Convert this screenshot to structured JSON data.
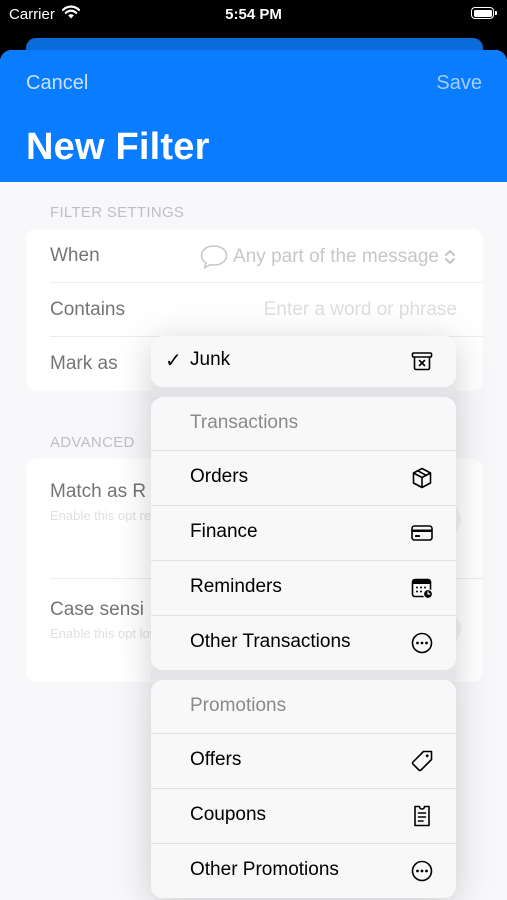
{
  "status_bar": {
    "carrier": "Carrier",
    "time": "5:54 PM"
  },
  "nav": {
    "cancel": "Cancel",
    "save": "Save",
    "title": "New Filter"
  },
  "filter_settings": {
    "header": "FILTER SETTINGS",
    "when_label": "When",
    "when_value": "Any part of the message",
    "contains_label": "Contains",
    "contains_placeholder": "Enter a word or phrase",
    "contains_value": "",
    "mark_as_label": "Mark as"
  },
  "advanced": {
    "header": "ADVANCED",
    "match_regex_title": "Match as R",
    "match_regex_desc": "Enable this opt regular express in PCRE format",
    "case_title": "Case sensi",
    "case_desc": "Enable this opt lowercase char"
  },
  "menu": {
    "selected": {
      "label": "Junk",
      "icon": "trash-x-icon"
    },
    "transactions": {
      "header": "Transactions",
      "items": [
        {
          "label": "Orders",
          "icon": "box-icon"
        },
        {
          "label": "Finance",
          "icon": "credit-card-icon"
        },
        {
          "label": "Reminders",
          "icon": "calendar-clock-icon"
        },
        {
          "label": "Other Transactions",
          "icon": "ellipsis-circle-icon"
        }
      ]
    },
    "promotions": {
      "header": "Promotions",
      "items": [
        {
          "label": "Offers",
          "icon": "tag-icon"
        },
        {
          "label": "Coupons",
          "icon": "coupon-icon"
        },
        {
          "label": "Other Promotions",
          "icon": "ellipsis-circle-icon"
        }
      ]
    }
  },
  "colors": {
    "accent": "#0a7cff",
    "background": "#f2f2f7"
  }
}
